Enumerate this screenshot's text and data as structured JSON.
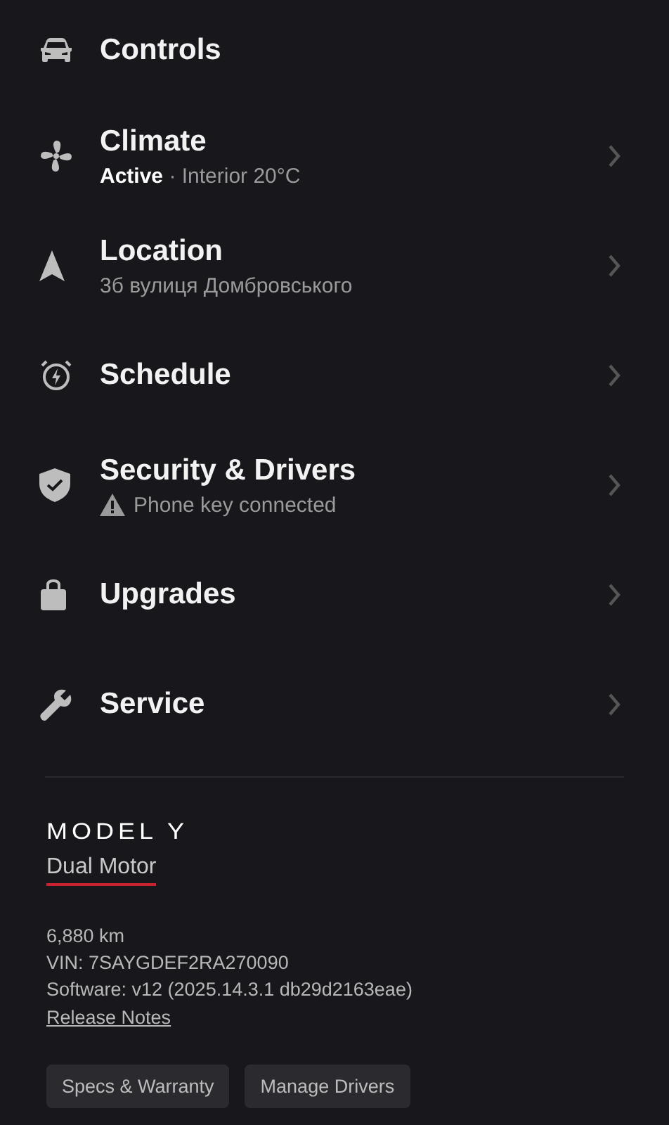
{
  "menu": [
    {
      "title": "Controls",
      "chevron": false
    },
    {
      "title": "Climate",
      "subtitle": "**Active** · Interior 20°C",
      "chevron": true
    },
    {
      "title": "Location",
      "subtitle": "3б вулиця Домбровського",
      "chevron": true
    },
    {
      "title": "Schedule",
      "chevron": true
    },
    {
      "title": "Security & Drivers",
      "subtitle": "Phone key connected",
      "warning": true,
      "chevron": true
    },
    {
      "title": "Upgrades",
      "chevron": true
    },
    {
      "title": "Service",
      "chevron": true
    }
  ],
  "vehicle": {
    "model": "MODEL Y",
    "trim": "Dual Motor",
    "odometer": "6,880 km",
    "vin": "VIN: 7SAYGDEF2RA270090",
    "software": "Software: v12 (2025.14.3.1 db29d2163eae)",
    "release_notes": "Release Notes"
  },
  "buttons": [
    "Specs & Warranty",
    "Manage Drivers"
  ]
}
